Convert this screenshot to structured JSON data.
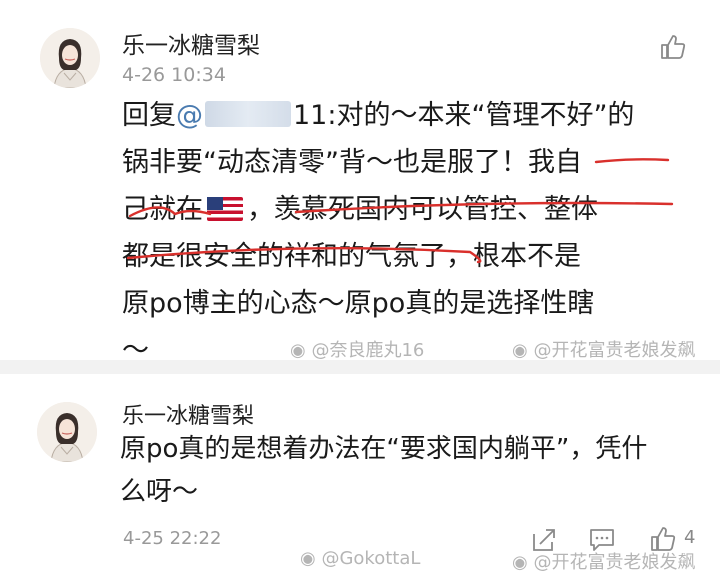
{
  "comments": [
    {
      "username": "乐一冰糖雪梨",
      "time": "4-26 10:34",
      "lines": [
        {
          "pre": "回复",
          "mention": "@",
          "post": "11:对的～本来“管理不好”的"
        },
        {
          "text": "锅非要“动态清零”背～也是服了！我自"
        },
        {
          "pre": "己就在",
          "post": "，羡慕死国内可以管控、整体"
        },
        {
          "text": "都是很安全的祥和的气氛了，根本不是"
        },
        {
          "text": "原po博主的心态～原po真的是选择性瞎"
        },
        {
          "text": "～"
        }
      ],
      "flag_icon": "us-flag-icon",
      "watermarks": [
        "@奈良鹿丸16",
        "@开花富贵老娘发飙"
      ]
    },
    {
      "username": "乐一冰糖雪梨",
      "time": "4-25 22:22",
      "lines": [
        {
          "text": "原po真的是想着办法在“要求国内躺平”，凭什"
        },
        {
          "text": "么呀～"
        }
      ],
      "like_count": "4",
      "watermarks": [
        "@GokottaL",
        "@开花富贵老娘发飙"
      ]
    }
  ],
  "colors": {
    "mention": "#4a7bb0",
    "underline": "#d9302c",
    "meta": "#999999",
    "separator": "#f2f2f2"
  },
  "icons": [
    "like-icon",
    "share-icon",
    "comment-icon",
    "weibo-logo-icon"
  ]
}
